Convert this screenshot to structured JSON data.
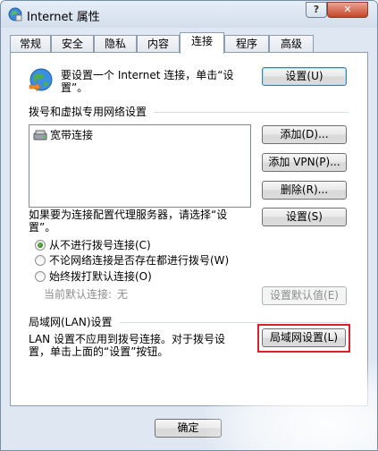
{
  "window": {
    "title": "Internet 属性",
    "help_label": "?",
    "close_label": "✕"
  },
  "tabs": [
    {
      "label": "常规"
    },
    {
      "label": "安全"
    },
    {
      "label": "隐私"
    },
    {
      "label": "内容"
    },
    {
      "label": "连接",
      "active": true
    },
    {
      "label": "程序"
    },
    {
      "label": "高级"
    }
  ],
  "setup": {
    "text_line1": "要设置一个 Internet 连接，单击“设",
    "text_line2": "置”。",
    "button": "设置(U)"
  },
  "dialup": {
    "heading": "拨号和虚拟专用网络设置",
    "connections": [
      {
        "name": "宽带连接"
      }
    ],
    "add_button": "添加(D)...",
    "add_vpn_button": "添加 VPN(P)...",
    "remove_button": "删除(R)...",
    "proxy_text_line1": "如果要为连接配置代理服务器，请选择“设",
    "proxy_text_line2": "置”。",
    "settings_button": "设置(S)",
    "options": [
      {
        "label": "从不进行拨号连接(C)",
        "checked": true
      },
      {
        "label": "不论网络连接是否存在都进行拨号(W)",
        "checked": false
      },
      {
        "label": "始终拨打默认连接(O)",
        "checked": false
      }
    ],
    "current_default_label": "当前默认连接:",
    "current_default_value": "无",
    "set_default_button": "设置默认值(E)"
  },
  "lan": {
    "heading": "局域网(LAN)设置",
    "text_line1": "LAN 设置不应用到拨号连接。对于拨号设",
    "text_line2": "置，单击上面的“设置”按钮。",
    "button": "局域网设置(L)"
  },
  "footer": {
    "ok_button": "确定"
  },
  "colors": {
    "highlight": "#d9202b",
    "radio_checked": "#2e8b2e"
  }
}
